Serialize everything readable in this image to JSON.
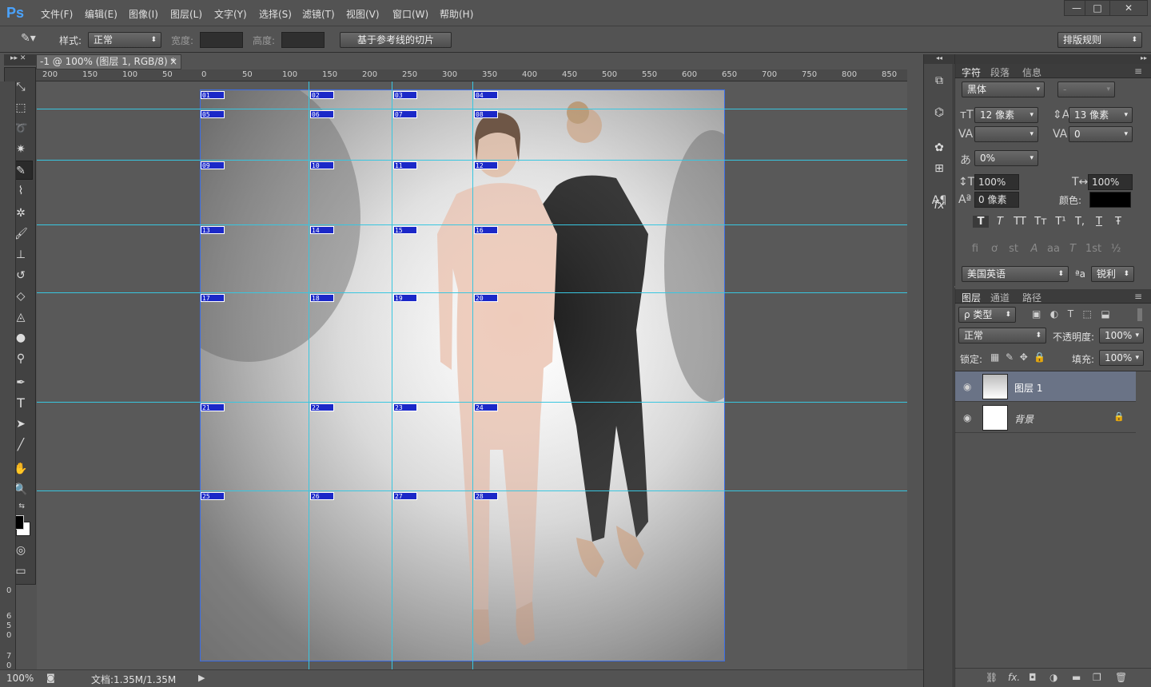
{
  "app": {
    "logo": "Ps"
  },
  "menu": [
    "文件(F)",
    "编辑(E)",
    "图像(I)",
    "图层(L)",
    "文字(Y)",
    "选择(S)",
    "滤镜(T)",
    "视图(V)",
    "窗口(W)",
    "帮助(H)"
  ],
  "window_controls": {
    "minimize": "—",
    "maximize": "□",
    "close": "✕"
  },
  "options": {
    "style_label": "样式:",
    "style_value": "正常",
    "width_label": "宽度:",
    "height_label": "高度:",
    "slice_button": "基于参考线的切片",
    "workspace": "排版规则"
  },
  "document": {
    "tab_title": "-1 @ 100% (图层 1, RGB/8) *",
    "tab_close": "×",
    "ruler_h": [
      "200",
      "150",
      "100",
      "50",
      "0",
      "50",
      "100",
      "150",
      "200",
      "250",
      "300",
      "350",
      "400",
      "450",
      "500",
      "550",
      "600",
      "650",
      "700",
      "750",
      "800",
      "850"
    ],
    "ruler_v": [
      "0",
      "6",
      "5",
      "0",
      "7",
      "0"
    ]
  },
  "slices": [
    "01",
    "02",
    "03",
    "04",
    "05",
    "06",
    "07",
    "08",
    "09",
    "10",
    "11",
    "12",
    "13",
    "14",
    "15",
    "16",
    "17",
    "18",
    "19",
    "20",
    "21",
    "22",
    "23",
    "24",
    "25",
    "26",
    "27",
    "28"
  ],
  "status": {
    "zoom": "100%",
    "doc": "文档:1.35M/1.35M"
  },
  "char_panel": {
    "tabs": [
      "字符",
      "段落",
      "信息"
    ],
    "font_family": "黑体",
    "font_style": "-",
    "font_size": "12 像素",
    "leading": "13 像素",
    "kerning": "",
    "tracking": "0",
    "scale_pct": "0%",
    "vscale": "100%",
    "hscale": "100%",
    "baseline": "0 像素",
    "color_label": "颜色:",
    "color_value": "#000000",
    "style_buttons": [
      "T",
      "T",
      "TT",
      "Tт",
      "T¹",
      "T,",
      "T",
      "Ŧ"
    ],
    "opentype_buttons": [
      "fi",
      "ơ",
      "st",
      "A",
      "aa",
      "T",
      "1st",
      "½"
    ],
    "language": "美国英语",
    "aa_label": "ªa",
    "antialias": "锐利"
  },
  "layers_panel": {
    "tabs": [
      "图层",
      "通道",
      "路径"
    ],
    "filter_kind": "ρ 类型",
    "blend_mode": "正常",
    "opacity_label": "不透明度:",
    "opacity": "100%",
    "lock_label": "锁定:",
    "fill_label": "填充:",
    "fill": "100%",
    "layers": [
      {
        "name": "图层 1",
        "selected": true
      },
      {
        "name": "背景",
        "selected": false,
        "locked": true
      }
    ],
    "bottom_icons": [
      "link-icon",
      "fx-icon",
      "mask-icon",
      "adjustment-icon",
      "folder-icon",
      "new-layer-icon",
      "trash-icon"
    ]
  }
}
